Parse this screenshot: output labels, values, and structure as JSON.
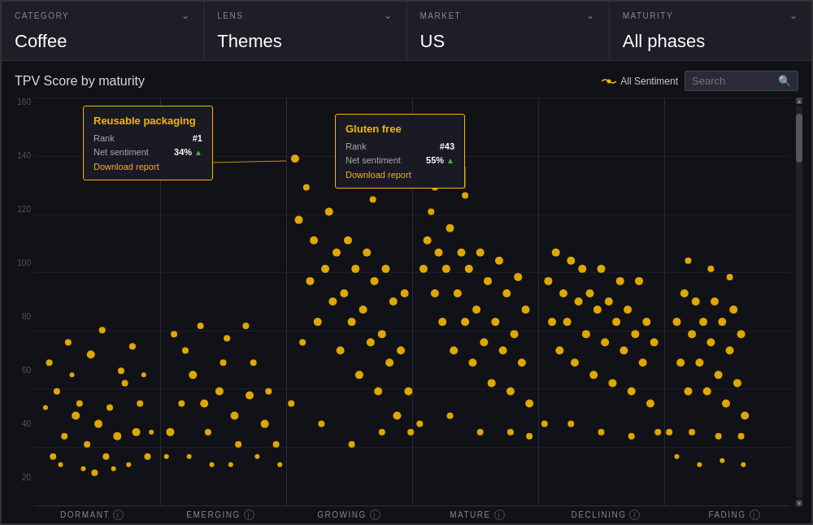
{
  "filterBar": {
    "items": [
      {
        "id": "category",
        "label": "CATEGORY",
        "value": "Coffee"
      },
      {
        "id": "lens",
        "label": "LENS",
        "value": "Themes"
      },
      {
        "id": "market",
        "label": "MARKET",
        "value": "US"
      },
      {
        "id": "maturity",
        "label": "MATURITY",
        "value": "All phases"
      }
    ]
  },
  "chart": {
    "title": "TPV Score by maturity",
    "sentimentLabel": "All Sentiment",
    "searchPlaceholder": "Search",
    "yAxisLabels": [
      "160",
      "140",
      "120",
      "100",
      "80",
      "60",
      "40",
      "20"
    ],
    "phases": [
      {
        "id": "dormant",
        "label": "DORMANT"
      },
      {
        "id": "emerging",
        "label": "EMERGING"
      },
      {
        "id": "growing",
        "label": "GROWING"
      },
      {
        "id": "mature",
        "label": "MATURE"
      },
      {
        "id": "declining",
        "label": "DECLINING"
      },
      {
        "id": "fading",
        "label": "FADING"
      }
    ],
    "tooltips": [
      {
        "id": "reusable-packaging",
        "title": "Reusable packaging",
        "rank": "#1",
        "sentiment": "34%",
        "downloadText": "Download report"
      },
      {
        "id": "gluten-free",
        "title": "Gluten free",
        "rank": "#43",
        "sentiment": "55%",
        "downloadText": "Download report"
      }
    ],
    "rowLabels": {
      "rank": "Rank",
      "netSentiment": "Net sentiment"
    }
  }
}
